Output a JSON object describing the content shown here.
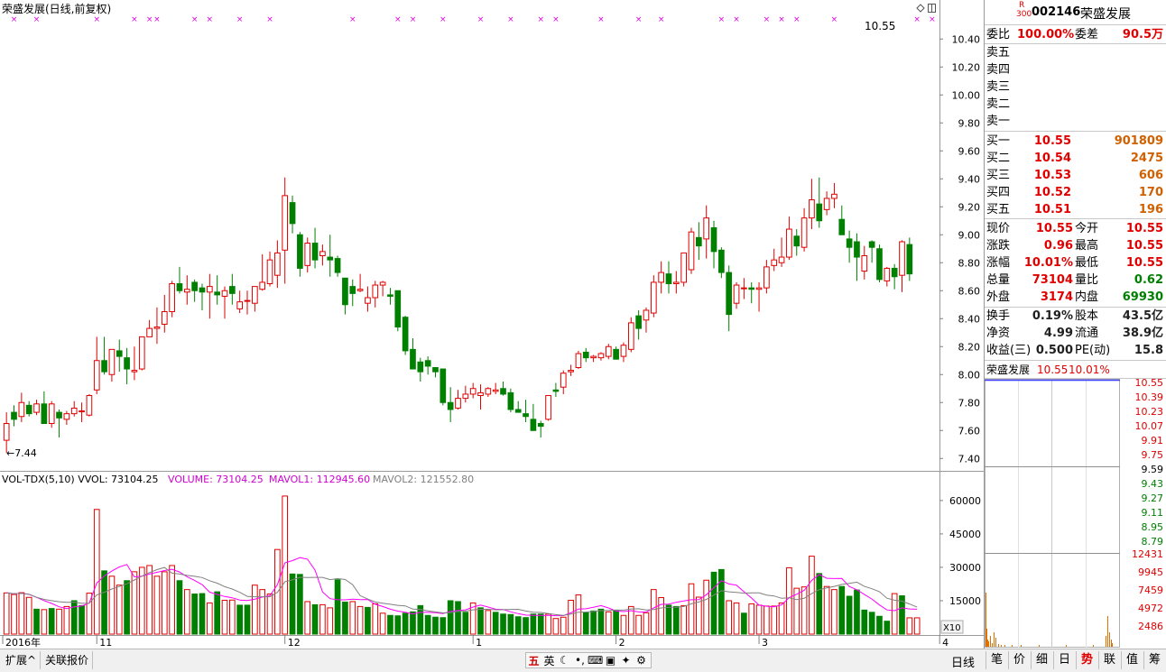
{
  "header": {
    "title": "荣盛发展(日线,前复权)",
    "top_right_price": "10.55"
  },
  "price_panel": {
    "y_ticks": [
      "10.40",
      "10.20",
      "10.00",
      "9.80",
      "9.60",
      "9.40",
      "9.20",
      "9.00",
      "8.80",
      "8.60",
      "8.40",
      "8.20",
      "8.00",
      "7.80",
      "7.60",
      "7.40"
    ],
    "low_marker": "7.44",
    "dates_x": [
      "2016年",
      "11",
      "12",
      "1",
      "2",
      "3",
      "4"
    ]
  },
  "volume_panel": {
    "title": "VOL-TDX(5,10)",
    "vvol_label": "VVOL: 73104.25",
    "volume_label": "VOLUME: 73104.25",
    "mavol1_label": "MAVOL1: 112945.60",
    "mavol2_label": "MAVOL2: 121552.80",
    "y_ticks": [
      "60000",
      "45000",
      "30000",
      "15000"
    ],
    "unit": "X10"
  },
  "chart_data": {
    "type": "candlestick",
    "title": "荣盛发展(日线,前复权)",
    "ylim": [
      7.35,
      10.55
    ],
    "candles": [
      [
        7.53,
        7.73,
        7.44,
        7.65
      ],
      [
        7.73,
        7.78,
        7.63,
        7.68
      ],
      [
        7.7,
        7.87,
        7.66,
        7.8
      ],
      [
        7.78,
        7.81,
        7.7,
        7.72
      ],
      [
        7.73,
        7.82,
        7.71,
        7.79
      ],
      [
        7.79,
        7.88,
        7.65,
        7.65
      ],
      [
        7.65,
        7.81,
        7.62,
        7.79
      ],
      [
        7.73,
        7.75,
        7.55,
        7.69
      ],
      [
        7.68,
        7.74,
        7.64,
        7.72
      ],
      [
        7.72,
        7.81,
        7.7,
        7.76
      ],
      [
        7.74,
        7.8,
        7.66,
        7.74
      ],
      [
        7.71,
        7.86,
        7.7,
        7.85
      ],
      [
        7.89,
        8.27,
        7.86,
        8.1
      ],
      [
        8.1,
        8.27,
        8.0,
        8.02
      ],
      [
        8.0,
        8.18,
        7.95,
        8.18
      ],
      [
        8.17,
        8.25,
        8.02,
        8.13
      ],
      [
        8.12,
        8.19,
        7.93,
        8.04
      ],
      [
        8.02,
        8.2,
        7.96,
        8.03
      ],
      [
        8.04,
        8.27,
        8.03,
        8.27
      ],
      [
        8.27,
        8.39,
        8.27,
        8.33
      ],
      [
        8.33,
        8.48,
        8.22,
        8.34
      ],
      [
        8.36,
        8.57,
        8.3,
        8.45
      ],
      [
        8.45,
        8.67,
        8.41,
        8.65
      ],
      [
        8.65,
        8.77,
        8.58,
        8.6
      ],
      [
        8.59,
        8.71,
        8.5,
        8.61
      ],
      [
        8.66,
        8.68,
        8.52,
        8.6
      ],
      [
        8.62,
        8.65,
        8.46,
        8.59
      ],
      [
        8.59,
        8.72,
        8.4,
        8.63
      ],
      [
        8.59,
        8.71,
        8.5,
        8.57
      ],
      [
        8.56,
        8.63,
        8.4,
        8.6
      ],
      [
        8.63,
        8.72,
        8.5,
        8.58
      ],
      [
        8.47,
        8.6,
        8.44,
        8.52
      ],
      [
        8.53,
        8.6,
        8.43,
        8.53
      ],
      [
        8.51,
        8.63,
        8.45,
        8.63
      ],
      [
        8.61,
        8.86,
        8.6,
        8.66
      ],
      [
        8.65,
        8.88,
        8.63,
        8.82
      ],
      [
        8.71,
        8.96,
        8.62,
        8.87
      ],
      [
        8.89,
        9.41,
        8.65,
        9.28
      ],
      [
        9.23,
        9.28,
        9.01,
        9.08
      ],
      [
        9.0,
        9.02,
        8.7,
        8.76
      ],
      [
        8.78,
        8.98,
        8.73,
        8.94
      ],
      [
        8.94,
        9.05,
        8.76,
        8.82
      ],
      [
        8.85,
        8.93,
        8.78,
        8.88
      ],
      [
        8.84,
        9.0,
        8.7,
        8.82
      ],
      [
        8.83,
        8.85,
        8.7,
        8.73
      ],
      [
        8.69,
        8.69,
        8.43,
        8.5
      ],
      [
        8.63,
        8.68,
        8.49,
        8.58
      ],
      [
        8.6,
        8.72,
        8.59,
        8.61
      ],
      [
        8.51,
        8.63,
        8.45,
        8.55
      ],
      [
        8.55,
        8.67,
        8.48,
        8.64
      ],
      [
        8.64,
        8.67,
        8.56,
        8.66
      ],
      [
        8.57,
        8.62,
        8.5,
        8.56
      ],
      [
        8.6,
        8.6,
        8.31,
        8.34
      ],
      [
        8.41,
        8.42,
        8.14,
        8.17
      ],
      [
        8.18,
        8.26,
        8.1,
        8.04
      ],
      [
        8.09,
        8.12,
        7.95,
        8.02
      ],
      [
        8.1,
        8.13,
        8.0,
        8.06
      ],
      [
        8.05,
        8.05,
        7.98,
        8.02
      ],
      [
        8.04,
        8.04,
        7.78,
        7.8
      ],
      [
        7.8,
        7.91,
        7.66,
        7.75
      ],
      [
        7.76,
        7.89,
        7.75,
        7.83
      ],
      [
        7.83,
        7.92,
        7.8,
        7.86
      ],
      [
        7.86,
        7.94,
        7.83,
        7.9
      ],
      [
        7.85,
        7.93,
        7.75,
        7.87
      ],
      [
        7.86,
        7.91,
        7.84,
        7.9
      ],
      [
        7.88,
        7.94,
        7.86,
        7.89
      ],
      [
        7.9,
        7.95,
        7.85,
        7.86
      ],
      [
        7.87,
        7.9,
        7.73,
        7.75
      ],
      [
        7.75,
        7.81,
        7.73,
        7.73
      ],
      [
        7.72,
        7.82,
        7.66,
        7.7
      ],
      [
        7.68,
        7.79,
        7.62,
        7.6
      ],
      [
        7.65,
        7.67,
        7.55,
        7.63
      ],
      [
        7.68,
        7.84,
        7.67,
        7.85
      ],
      [
        7.89,
        7.94,
        7.84,
        7.88
      ],
      [
        7.91,
        8.03,
        7.86,
        8.01
      ],
      [
        8.02,
        8.07,
        7.99,
        8.03
      ],
      [
        8.05,
        8.17,
        8.04,
        8.15
      ],
      [
        8.16,
        8.19,
        8.09,
        8.12
      ],
      [
        8.12,
        8.14,
        8.09,
        8.13
      ],
      [
        8.12,
        8.16,
        8.1,
        8.15
      ],
      [
        8.13,
        8.22,
        8.11,
        8.2
      ],
      [
        8.18,
        8.2,
        8.11,
        8.11
      ],
      [
        8.13,
        8.23,
        8.09,
        8.21
      ],
      [
        8.18,
        8.41,
        8.16,
        8.37
      ],
      [
        8.42,
        8.46,
        8.25,
        8.33
      ],
      [
        8.39,
        8.48,
        8.3,
        8.46
      ],
      [
        8.44,
        8.71,
        8.41,
        8.66
      ],
      [
        8.66,
        8.81,
        8.58,
        8.73
      ],
      [
        8.72,
        8.81,
        8.58,
        8.65
      ],
      [
        8.65,
        8.74,
        8.58,
        8.66
      ],
      [
        8.66,
        8.86,
        8.63,
        8.87
      ],
      [
        8.75,
        9.05,
        8.72,
        9.02
      ],
      [
        8.98,
        9.09,
        8.82,
        8.92
      ],
      [
        8.97,
        9.21,
        8.83,
        9.12
      ],
      [
        9.05,
        9.1,
        8.76,
        8.88
      ],
      [
        8.89,
        8.91,
        8.69,
        8.73
      ],
      [
        8.73,
        8.78,
        8.31,
        8.43
      ],
      [
        8.51,
        8.66,
        8.47,
        8.64
      ],
      [
        8.62,
        8.69,
        8.54,
        8.62
      ],
      [
        8.62,
        8.66,
        8.51,
        8.61
      ],
      [
        8.61,
        8.66,
        8.45,
        8.62
      ],
      [
        8.62,
        8.82,
        8.58,
        8.77
      ],
      [
        8.78,
        8.9,
        8.74,
        8.82
      ],
      [
        8.8,
        8.98,
        8.77,
        8.84
      ],
      [
        8.84,
        9.13,
        8.82,
        9.04
      ],
      [
        8.99,
        9.04,
        8.85,
        8.92
      ],
      [
        8.91,
        9.19,
        8.88,
        9.12
      ],
      [
        9.12,
        9.4,
        9.04,
        9.25
      ],
      [
        9.22,
        9.41,
        9.05,
        9.1
      ],
      [
        9.18,
        9.31,
        9.14,
        9.26
      ],
      [
        9.26,
        9.37,
        9.19,
        9.29
      ],
      [
        9.11,
        9.21,
        9.0,
        9.0
      ],
      [
        8.97,
        9.03,
        8.8,
        8.91
      ],
      [
        8.95,
        9.01,
        8.67,
        8.84
      ],
      [
        8.74,
        8.92,
        8.68,
        8.85
      ],
      [
        8.95,
        8.96,
        8.8,
        8.91
      ],
      [
        8.9,
        8.93,
        8.66,
        8.68
      ],
      [
        8.67,
        8.77,
        8.63,
        8.76
      ],
      [
        8.76,
        8.79,
        8.61,
        8.7
      ],
      [
        8.71,
        8.96,
        8.59,
        8.95
      ],
      [
        8.93,
        8.98,
        8.67,
        8.72
      ]
    ],
    "volume": [
      [
        18500,
        "r"
      ],
      [
        17800,
        "r"
      ],
      [
        18600,
        "r"
      ],
      [
        16500,
        "r"
      ],
      [
        11200,
        "g"
      ],
      [
        11000,
        "r"
      ],
      [
        11500,
        "g"
      ],
      [
        11200,
        "r"
      ],
      [
        12400,
        "r"
      ],
      [
        15000,
        "g"
      ],
      [
        12800,
        "g"
      ],
      [
        18400,
        "r"
      ],
      [
        56000,
        "r"
      ],
      [
        28400,
        "g"
      ],
      [
        26000,
        "r"
      ],
      [
        22000,
        "r"
      ],
      [
        24000,
        "g"
      ],
      [
        28000,
        "r"
      ],
      [
        30000,
        "r"
      ],
      [
        30800,
        "r"
      ],
      [
        26000,
        "r"
      ],
      [
        28000,
        "r"
      ],
      [
        30800,
        "r"
      ],
      [
        24000,
        "g"
      ],
      [
        20000,
        "r"
      ],
      [
        18000,
        "g"
      ],
      [
        18200,
        "g"
      ],
      [
        14000,
        "r"
      ],
      [
        19000,
        "g"
      ],
      [
        15200,
        "r"
      ],
      [
        15300,
        "r"
      ],
      [
        13000,
        "g"
      ],
      [
        13000,
        "g"
      ],
      [
        22000,
        "r"
      ],
      [
        20000,
        "r"
      ],
      [
        18000,
        "r"
      ],
      [
        38000,
        "r"
      ],
      [
        62000,
        "r"
      ],
      [
        27000,
        "g"
      ],
      [
        26800,
        "g"
      ],
      [
        14600,
        "r"
      ],
      [
        13200,
        "g"
      ],
      [
        13200,
        "r"
      ],
      [
        11800,
        "r"
      ],
      [
        24400,
        "g"
      ],
      [
        14400,
        "g"
      ],
      [
        14600,
        "r"
      ],
      [
        12400,
        "r"
      ],
      [
        12000,
        "g"
      ],
      [
        13600,
        "r"
      ],
      [
        9400,
        "r"
      ],
      [
        8400,
        "g"
      ],
      [
        8200,
        "g"
      ],
      [
        9400,
        "g"
      ],
      [
        10000,
        "g"
      ],
      [
        12800,
        "g"
      ],
      [
        8400,
        "g"
      ],
      [
        7600,
        "g"
      ],
      [
        7400,
        "g"
      ],
      [
        15000,
        "g"
      ],
      [
        14600,
        "g"
      ],
      [
        9800,
        "g"
      ],
      [
        14000,
        "r"
      ],
      [
        11800,
        "g"
      ],
      [
        10600,
        "r"
      ],
      [
        9800,
        "g"
      ],
      [
        9000,
        "g"
      ],
      [
        8800,
        "g"
      ],
      [
        7800,
        "g"
      ],
      [
        7400,
        "g"
      ],
      [
        9000,
        "g"
      ],
      [
        9000,
        "g"
      ],
      [
        9000,
        "r"
      ],
      [
        7000,
        "r"
      ],
      [
        7600,
        "r"
      ],
      [
        15200,
        "r"
      ],
      [
        17600,
        "r"
      ],
      [
        9600,
        "g"
      ],
      [
        10400,
        "g"
      ],
      [
        11200,
        "g"
      ],
      [
        10000,
        "r"
      ],
      [
        10600,
        "g"
      ],
      [
        8400,
        "r"
      ],
      [
        12400,
        "r"
      ],
      [
        8400,
        "r"
      ],
      [
        9600,
        "r"
      ],
      [
        20000,
        "r"
      ],
      [
        16400,
        "r"
      ],
      [
        13000,
        "g"
      ],
      [
        12400,
        "g"
      ],
      [
        12800,
        "r"
      ],
      [
        22600,
        "r"
      ],
      [
        16600,
        "r"
      ],
      [
        24200,
        "r"
      ],
      [
        27800,
        "g"
      ],
      [
        29000,
        "g"
      ],
      [
        15000,
        "r"
      ],
      [
        14000,
        "r"
      ],
      [
        9400,
        "g"
      ],
      [
        13600,
        "r"
      ],
      [
        13000,
        "r"
      ],
      [
        12600,
        "r"
      ],
      [
        12600,
        "r"
      ],
      [
        14000,
        "r"
      ],
      [
        29800,
        "r"
      ],
      [
        20600,
        "r"
      ],
      [
        21200,
        "r"
      ],
      [
        35000,
        "r"
      ],
      [
        27200,
        "g"
      ],
      [
        21400,
        "r"
      ],
      [
        20000,
        "r"
      ],
      [
        21400,
        "g"
      ],
      [
        17000,
        "g"
      ],
      [
        19800,
        "g"
      ],
      [
        10800,
        "g"
      ],
      [
        9800,
        "g"
      ],
      [
        8000,
        "g"
      ],
      [
        5800,
        "g"
      ],
      [
        18200,
        "r"
      ],
      [
        17200,
        "g"
      ],
      [
        7310,
        "r"
      ],
      [
        7310,
        "r"
      ]
    ],
    "volume_ylim": [
      0,
      64000
    ]
  },
  "info_panel": {
    "code": "002146",
    "name": "荣盛发展",
    "badge_r": "R",
    "badge_num": "300",
    "wei_bi_label": "委比",
    "wei_bi": "100.00%",
    "wei_cha_label": "委差",
    "wei_cha": "90.5万",
    "sell": [
      {
        "label": "卖五"
      },
      {
        "label": "卖四"
      },
      {
        "label": "卖三"
      },
      {
        "label": "卖二"
      },
      {
        "label": "卖一"
      }
    ],
    "buy": [
      {
        "label": "买一",
        "price": "10.55",
        "vol": "901809"
      },
      {
        "label": "买二",
        "price": "10.54",
        "vol": "2475"
      },
      {
        "label": "买三",
        "price": "10.53",
        "vol": "606"
      },
      {
        "label": "买四",
        "price": "10.52",
        "vol": "170"
      },
      {
        "label": "买五",
        "price": "10.51",
        "vol": "196"
      }
    ],
    "stats": [
      {
        "l1": "现价",
        "v1": "10.55",
        "l2": "今开",
        "v2": "10.55"
      },
      {
        "l1": "涨跌",
        "v1": "0.96",
        "l2": "最高",
        "v2": "10.55"
      },
      {
        "l1": "涨幅",
        "v1": "10.01%",
        "l2": "最低",
        "v2": "10.55"
      },
      {
        "l1": "总量",
        "v1": "73104",
        "l2": "量比",
        "v2": "0.62"
      },
      {
        "l1": "外盘",
        "v1": "3174",
        "l2": "内盘",
        "v2": "69930"
      }
    ],
    "stats2": [
      {
        "l1": "换手",
        "v1": "0.19%",
        "l2": "股本",
        "v2": "43.5亿"
      },
      {
        "l1": "净资",
        "v1": "4.99",
        "l2": "流通",
        "v2": "38.9亿"
      },
      {
        "l1": "收益(三)",
        "v1": "0.500",
        "l2": "PE(动)",
        "v2": "15.8"
      }
    ]
  },
  "mini_chart": {
    "name": "荣盛发展",
    "price": "10.55",
    "pct": "10.01%",
    "price_ticks": [
      "10.55",
      "10.39",
      "10.23",
      "10.07",
      "9.91",
      "9.75",
      "9.59",
      "9.43",
      "9.27",
      "9.11",
      "8.95",
      "8.79"
    ],
    "vol_ticks": [
      "12431",
      "9945",
      "7459",
      "4972",
      "2486"
    ]
  },
  "bottom": {
    "tabs": [
      "扩展^",
      "关联报价"
    ],
    "ime": [
      "五",
      "英",
      "☾",
      "•,",
      "⌨",
      "▣",
      "✦",
      "⚙"
    ],
    "period": "日线",
    "right_tabs": [
      "笔",
      "价",
      "细",
      "日",
      "势",
      "联",
      "值",
      "筹"
    ],
    "active_right_tab": "势"
  },
  "colors": {
    "up": "#e00000",
    "down": "#008000",
    "mavol1": "#ff00ff",
    "mavol2": "#808080",
    "grid": "#c0c0c0"
  }
}
